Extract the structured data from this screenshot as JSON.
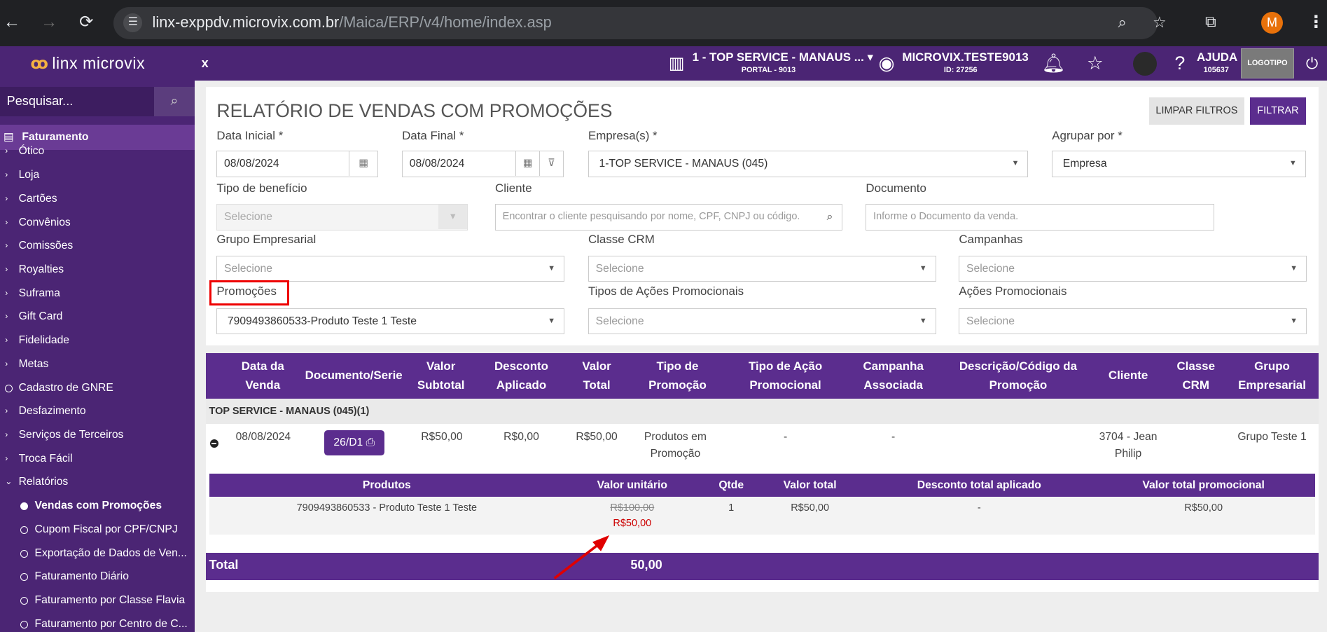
{
  "browser": {
    "url_host": "linx-exppdv.microvix.com.br",
    "url_path": "/Maica/ERP/v4/home/index.asp",
    "avatar_letter": "M"
  },
  "topbar": {
    "logo": "linx microvix",
    "close": "x",
    "company": "1 - TOP SERVICE - MANAUS ...",
    "portal": "PORTAL - 9013",
    "user": "MICROVIX.TESTE9013",
    "user_id": "ID: 27256",
    "help": "AJUDA",
    "help_code": "105637",
    "logotipo": "LOGOTIPO"
  },
  "sidebar": {
    "search_placeholder": "Pesquisar...",
    "section": "Faturamento",
    "items": [
      {
        "label": "Ótico",
        "type": "arrow"
      },
      {
        "label": "Loja",
        "type": "arrow"
      },
      {
        "label": "Cartões",
        "type": "arrow"
      },
      {
        "label": "Convênios",
        "type": "arrow"
      },
      {
        "label": "Comissões",
        "type": "arrow"
      },
      {
        "label": "Royalties",
        "type": "arrow"
      },
      {
        "label": "Suframa",
        "type": "arrow"
      },
      {
        "label": "Gift Card",
        "type": "arrow"
      },
      {
        "label": "Fidelidade",
        "type": "arrow"
      },
      {
        "label": "Metas",
        "type": "arrow"
      },
      {
        "label": "Cadastro de GNRE",
        "type": "circle"
      },
      {
        "label": "Desfazimento",
        "type": "arrow"
      },
      {
        "label": "Serviços de Terceiros",
        "type": "arrow"
      },
      {
        "label": "Troca Fácil",
        "type": "arrow"
      },
      {
        "label": "Relatórios",
        "type": "open"
      },
      {
        "label": "Vendas com Promoções",
        "type": "sub-active"
      },
      {
        "label": "Cupom Fiscal por CPF/CNPJ",
        "type": "sub"
      },
      {
        "label": "Exportação de Dados de Ven...",
        "type": "sub"
      },
      {
        "label": "Faturamento Diário",
        "type": "sub"
      },
      {
        "label": "Faturamento por Classe Flavia",
        "type": "sub"
      },
      {
        "label": "Faturamento por Centro de C...",
        "type": "sub"
      }
    ]
  },
  "page": {
    "title": "RELATÓRIO DE VENDAS COM PROMOÇÕES",
    "btn_clear": "LIMPAR FILTROS",
    "btn_filter": "FILTRAR"
  },
  "filters": {
    "data_inicial_label": "Data Inicial *",
    "data_inicial": "08/08/2024",
    "data_final_label": "Data Final *",
    "data_final": "08/08/2024",
    "empresa_label": "Empresa(s) *",
    "empresa": "1-TOP SERVICE - MANAUS (045)",
    "agrupar_label": "Agrupar por *",
    "agrupar": "Empresa",
    "beneficio_label": "Tipo de benefício",
    "beneficio": "Selecione",
    "cliente_label": "Cliente",
    "cliente_ph": "Encontrar o cliente pesquisando por nome, CPF, CNPJ ou código.",
    "documento_label": "Documento",
    "documento_ph": "Informe o Documento da venda.",
    "grupo_label": "Grupo Empresarial",
    "grupo": "Selecione",
    "classe_label": "Classe CRM",
    "classe": "Selecione",
    "campanhas_label": "Campanhas",
    "campanhas": "Selecione",
    "promocoes_label": "Promoções",
    "promocoes": "7909493860533-Produto Teste 1 Teste",
    "tipos_acoes_label": "Tipos de Ações Promocionais",
    "tipos_acoes": "Selecione",
    "acoes_label": "Ações Promocionais",
    "acoes": "Selecione"
  },
  "table": {
    "headers": [
      [
        "Data da",
        "Venda"
      ],
      [
        "Documento/Serie",
        ""
      ],
      [
        "Valor",
        "Subtotal"
      ],
      [
        "Desconto",
        "Aplicado"
      ],
      [
        "Valor",
        "Total"
      ],
      [
        "Tipo de",
        "Promoção"
      ],
      [
        "Tipo de Ação",
        "Promocional"
      ],
      [
        "Campanha",
        "Associada"
      ],
      [
        "Descrição/Código da",
        "Promoção"
      ],
      [
        "Cliente",
        ""
      ],
      [
        "Classe",
        "CRM"
      ],
      [
        "Grupo",
        "Empresarial"
      ]
    ],
    "group": "TOP SERVICE - MANAUS (045)(1)",
    "row": {
      "data": "08/08/2024",
      "doc": "26/D1",
      "subtotal": "R$50,00",
      "desconto": "R$0,00",
      "total": "R$50,00",
      "tipo1": "Produtos em",
      "tipo2": "Promoção",
      "acao": "-",
      "campanha": "-",
      "cliente1": "3704 - Jean",
      "cliente2": "Philip",
      "grupo": "Grupo Teste 1"
    },
    "sub_headers": [
      "Produtos",
      "Valor unitário",
      "Qtde",
      "Valor total",
      "Desconto total aplicado",
      "Valor total promocional"
    ],
    "sub_row": {
      "produto": "7909493860533 - Produto Teste 1 Teste",
      "unit_old": "R$100,00",
      "unit_new": "R$50,00",
      "qtde": "1",
      "valor_total": "R$50,00",
      "desconto": "-",
      "promocional": "R$50,00"
    },
    "total_label": "Total",
    "total_value": "50,00"
  },
  "colors": {
    "brand": "#4b2574",
    "accent": "#5b2d8e",
    "highlight": "#e00000"
  }
}
